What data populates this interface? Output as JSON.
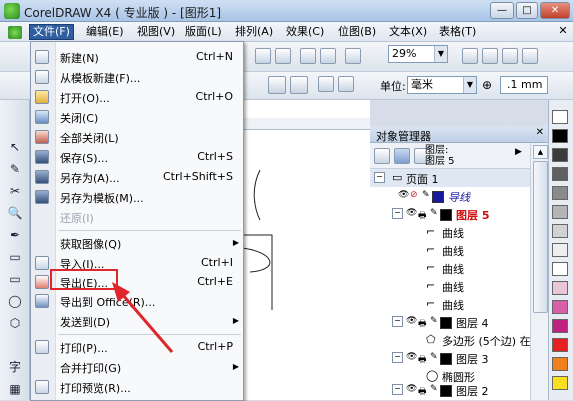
{
  "window": {
    "title": "CorelDRAW X4 ( 专业版 ) - [图形1]",
    "minimize": "—",
    "maximize": "□",
    "close": "✕",
    "mdi_close": "✕"
  },
  "menubar": [
    {
      "label": "文件(F)",
      "active": true
    },
    {
      "label": "编辑(E)"
    },
    {
      "label": "视图(V)"
    },
    {
      "label": "版面(L)"
    },
    {
      "label": "排列(A)"
    },
    {
      "label": "效果(C)"
    },
    {
      "label": "位图(B)"
    },
    {
      "label": "文本(X)"
    },
    {
      "label": "表格(T)"
    }
  ],
  "toolbar": {
    "zoom": "29%",
    "unit_label": "单位:",
    "unit_value": "毫米",
    "nudge_value": ".1 mm"
  },
  "file_menu": [
    {
      "label": "新建(N)",
      "shortcut": "Ctrl+N",
      "icon": "new-icon"
    },
    {
      "label": "从模板新建(F)...",
      "shortcut": "",
      "icon": "template-icon"
    },
    {
      "label": "打开(O)...",
      "shortcut": "Ctrl+O",
      "icon": "open-icon"
    },
    {
      "label": "关闭(C)",
      "shortcut": "",
      "icon": "close-doc-icon"
    },
    {
      "label": "全部关闭(L)",
      "shortcut": "",
      "icon": "close-all-icon"
    },
    {
      "label": "保存(S)...",
      "shortcut": "Ctrl+S",
      "icon": "save-icon"
    },
    {
      "label": "另存为(A)...",
      "shortcut": "Ctrl+Shift+S",
      "icon": "save-as-icon"
    },
    {
      "label": "另存为模板(M)...",
      "shortcut": "",
      "icon": "save-template-icon"
    },
    {
      "label": "还原(I)",
      "shortcut": "",
      "disabled": true
    },
    {
      "label": "获取图像(Q)",
      "shortcut": "",
      "submenu": true
    },
    {
      "label": "导入(I)...",
      "shortcut": "Ctrl+I",
      "icon": "import-icon"
    },
    {
      "label": "导出(E)...",
      "shortcut": "Ctrl+E",
      "icon": "export-icon"
    },
    {
      "label": "导出到 Office(R)...",
      "shortcut": "",
      "icon": "export-office-icon"
    },
    {
      "label": "发送到(D)",
      "shortcut": "",
      "submenu": true
    },
    {
      "label": "打印(P)...",
      "shortcut": "Ctrl+P",
      "icon": "print-icon"
    },
    {
      "label": "合并打印(G)",
      "shortcut": "",
      "submenu": true
    },
    {
      "label": "打印预览(R)...",
      "shortcut": "",
      "icon": "print-preview-icon"
    }
  ],
  "object_manager": {
    "title": "对象管理器",
    "close": "✕",
    "layer_header": "图层:\n图层 5",
    "layer_prefix": "图层:",
    "layer_current": "图层 5",
    "page": "页面 1",
    "rows": [
      {
        "kind": "layer",
        "label": "导线",
        "color": "#1a1aa0",
        "text_color": "#1a1aa0"
      },
      {
        "kind": "layer",
        "label": "图层 5",
        "color": "#000000",
        "text_color": "#d01010"
      },
      {
        "kind": "curve",
        "label": "曲线"
      },
      {
        "kind": "curve",
        "label": "曲线"
      },
      {
        "kind": "curve",
        "label": "曲线"
      },
      {
        "kind": "curve",
        "label": "曲线"
      },
      {
        "kind": "curve",
        "label": "曲线"
      },
      {
        "kind": "layer",
        "label": "图层 4",
        "color": "#000000"
      },
      {
        "kind": "object",
        "label": "多边形 (5个边) 在 图"
      },
      {
        "kind": "layer",
        "label": "图层 3",
        "color": "#000000"
      },
      {
        "kind": "object",
        "label": "椭圆形"
      },
      {
        "kind": "layer",
        "label": "图层 2",
        "color": "#000000"
      },
      {
        "kind": "object",
        "label": "椭圆形"
      }
    ]
  },
  "palette_colors": [
    "#ffffff",
    "#000000",
    "#3b3b3b",
    "#606060",
    "#8a8a8a",
    "#b4b4b4",
    "#d2d2d2",
    "#eeeeee",
    "#ffffff",
    "#e8c6d8",
    "#d860a8",
    "#c02080",
    "#e62020",
    "#f08020",
    "#f8e020"
  ],
  "tools": [
    "↖",
    "✎",
    "✂",
    "🔍",
    "✒",
    "▭",
    "◯",
    "⬡",
    "字",
    "▦",
    "🎨"
  ]
}
